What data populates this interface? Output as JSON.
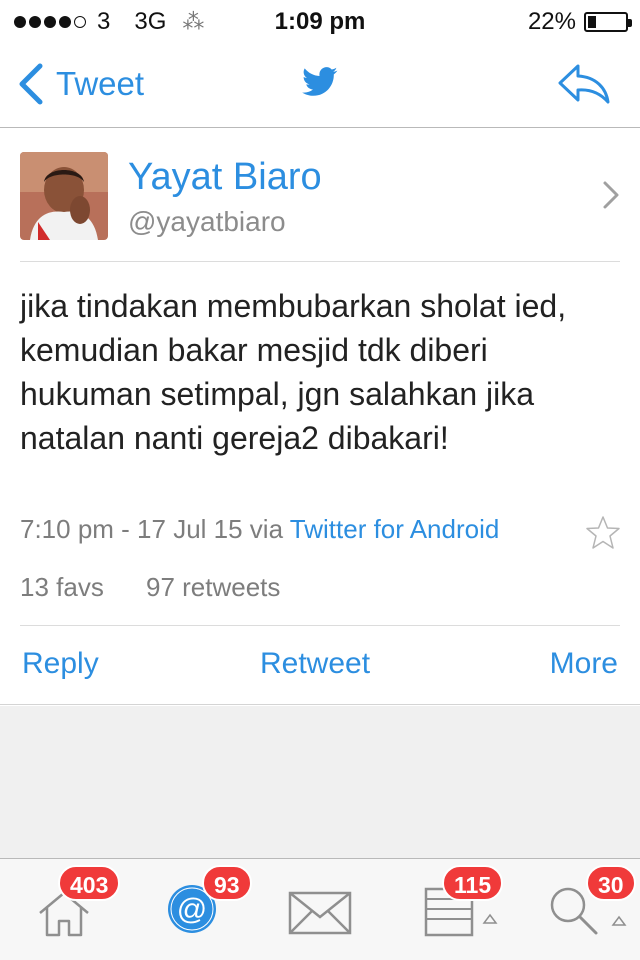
{
  "status_bar": {
    "carrier": "3",
    "network": "3G",
    "time": "1:09 pm",
    "battery": "22%",
    "battery_level": 0.22
  },
  "nav": {
    "back_label": "Tweet",
    "logo_icon": "twitter-bird-icon",
    "action_icon": "reply-arrow-icon",
    "accent_color": "#2c8ee0"
  },
  "tweet": {
    "author_name": "Yayat Biaro",
    "author_handle": "@yayatbiaro",
    "text": "jika tindakan membubarkan sholat ied, kemudian bakar mesjid tdk diberi hukuman setimpal, jgn salahkan jika natalan nanti gereja2 dibakari!",
    "timestamp": "7:10 pm - 17 Jul 15 via ",
    "source": "Twitter for Android",
    "favs": "13 favs",
    "retweets": "97 retweets"
  },
  "actions": {
    "reply": "Reply",
    "retweet": "Retweet",
    "more": "More"
  },
  "tab_bar": {
    "tabs": [
      {
        "icon": "home-icon",
        "badge": "403"
      },
      {
        "icon": "mentions-icon",
        "badge": "93"
      },
      {
        "icon": "messages-icon",
        "badge": ""
      },
      {
        "icon": "lists-icon",
        "badge": "115"
      },
      {
        "icon": "search-icon",
        "badge": "30"
      }
    ],
    "badge_color": "#f03a3a"
  }
}
